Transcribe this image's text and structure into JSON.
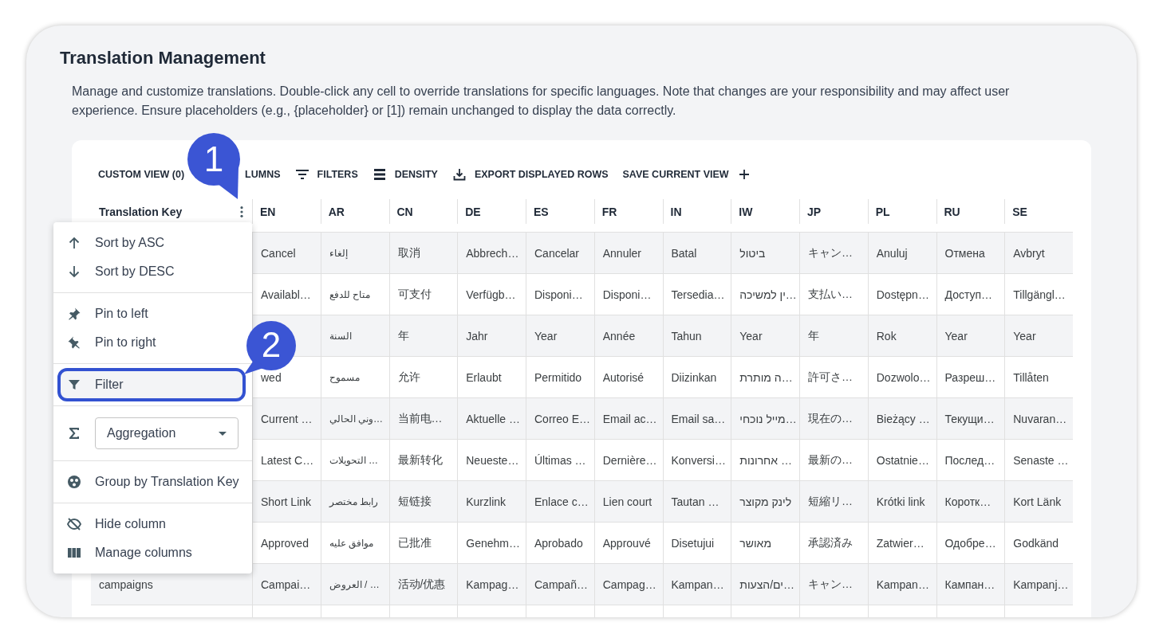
{
  "title": "Translation Management",
  "description": "Manage and customize translations. Double-click any cell to override translations for specific languages. Note that changes are your responsibility and may affect user experience. Ensure placeholders (e.g., {placeholder} or [1]) remain unchanged to display the data correctly.",
  "toolbar": [
    {
      "label": "CUSTOM VIEW (0)",
      "kind": "plain"
    },
    {
      "label": "LUMNS",
      "kind": "plain"
    },
    {
      "label": "FILTERS",
      "kind": "filters"
    },
    {
      "label": "DENSITY",
      "kind": "density"
    },
    {
      "label": "EXPORT DISPLAYED ROWS",
      "kind": "export"
    },
    {
      "label": "SAVE CURRENT VIEW",
      "kind": "save"
    }
  ],
  "table": {
    "columns": [
      "Translation Key",
      "EN",
      "AR",
      "CN",
      "DE",
      "ES",
      "FR",
      "IN",
      "IW",
      "JP",
      "PL",
      "RU",
      "SE"
    ],
    "rows": [
      {
        "cells": [
          "",
          "Cancel",
          "إلغاء",
          "取消",
          "Abbrech…",
          "Cancelar",
          "Annuler",
          "Batal",
          "ביטול",
          "キャン…",
          "Anuluj",
          "Отмена",
          "Avbryt"
        ]
      },
      {
        "cells": [
          "",
          "Availabl…",
          "متاح للدفع",
          "可支付",
          "Verfügb…",
          "Disponi…",
          "Disponi…",
          "Tersedia…",
          "…ין למשיכה",
          "支払い…",
          "Dostępn…",
          "Доступ…",
          "Tillgängl…"
        ]
      },
      {
        "cells": [
          "",
          "",
          "السنة",
          "年",
          "Jahr",
          "Year",
          "Année",
          "Tahun",
          "Year",
          "年",
          "Rok",
          "Year",
          "Year"
        ]
      },
      {
        "cells": [
          "",
          "wed",
          "مسموح",
          "允许",
          "Erlaubt",
          "Permitido",
          "Autorisé",
          "Diizinkan",
          "…ה מותרת",
          "許可さ…",
          "Dozwolo…",
          "Разреш…",
          "Tillåten"
        ]
      },
      {
        "cells": [
          "",
          "Current …",
          "…وني الحالي",
          "当前电…",
          "Aktuelle …",
          "Correo E…",
          "Email ac…",
          "Email sa…",
          "…מייל נוכחי",
          "現在の…",
          "Bieżący …",
          "Текущи…",
          "Nuvaran…"
        ]
      },
      {
        "cells": [
          "",
          "Latest C…",
          "… التحويلات",
          "最新转化",
          "Neueste…",
          "Últimas …",
          "Dernière…",
          "Konversi…",
          "… אחרונות",
          "最新の…",
          "Ostatnie…",
          "Послед…",
          "Senaste …"
        ]
      },
      {
        "cells": [
          "",
          "Short Link",
          "رابط مختصر",
          "短链接",
          "Kurzlink",
          "Enlace c…",
          "Lien court",
          "Tautan …",
          "לינק מקוצר",
          "短縮リ…",
          "Krótki link",
          "Коротк…",
          "Kort Länk"
        ]
      },
      {
        "cells": [
          "",
          "Approved",
          "موافق عليه",
          "已批准",
          "Genehm…",
          "Aprobado",
          "Approuvé",
          "Disetujui",
          "מאושר",
          "承認済み",
          "Zatwier…",
          "Одобре…",
          "Godkänd"
        ]
      },
      {
        "cells": [
          "campaigns",
          "Campai…",
          "… / العروض",
          "活动/优惠",
          "Kampag…",
          "Campañ…",
          "Campag…",
          "Kampan…",
          "…ים/הצעות",
          "キャン…",
          "Kampan…",
          "Кампан…",
          "Kampanj…"
        ]
      }
    ]
  },
  "column_menu": {
    "groups": [
      {
        "items": [
          {
            "kind": "ascending",
            "label": "Sort by ASC",
            "selected": false
          },
          {
            "kind": "descending",
            "label": "Sort by DESC",
            "selected": false
          }
        ]
      },
      {
        "items": [
          {
            "kind": "pinleft",
            "label": "Pin to left",
            "selected": false
          },
          {
            "kind": "pinright",
            "label": "Pin to right",
            "selected": false
          }
        ]
      },
      {
        "items": [
          {
            "kind": "filter",
            "label": "Filter",
            "selected": true
          }
        ]
      },
      {
        "items": [
          {
            "kind": "aggregation",
            "label": "Aggregation"
          }
        ]
      },
      {
        "items": [
          {
            "kind": "group",
            "label": "Group by Translation Key",
            "selected": false
          }
        ]
      },
      {
        "items": [
          {
            "kind": "hide",
            "label": "Hide column",
            "selected": false
          },
          {
            "kind": "columns",
            "label": "Manage columns",
            "selected": false
          }
        ]
      }
    ]
  },
  "callouts": [
    {
      "number": "1"
    },
    {
      "number": "2"
    }
  ]
}
